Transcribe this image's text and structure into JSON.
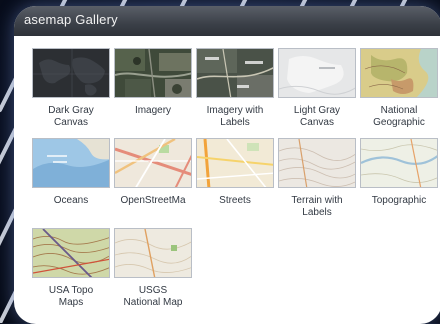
{
  "gallery": {
    "title": "asemap Gallery",
    "items": [
      {
        "label": "Dark Gray\nCanvas",
        "icon": "dark-gray-canvas-thumbnail"
      },
      {
        "label": "Imagery",
        "icon": "imagery-thumbnail"
      },
      {
        "label": "Imagery with\nLabels",
        "icon": "imagery-with-labels-thumbnail"
      },
      {
        "label": "Light Gray\nCanvas",
        "icon": "light-gray-canvas-thumbnail"
      },
      {
        "label": "National\nGeographic",
        "icon": "national-geographic-thumbnail"
      },
      {
        "label": "Oceans",
        "icon": "oceans-thumbnail"
      },
      {
        "label": "OpenStreetMa",
        "icon": "openstreetmap-thumbnail"
      },
      {
        "label": "Streets",
        "icon": "streets-thumbnail"
      },
      {
        "label": "Terrain with\nLabels",
        "icon": "terrain-with-labels-thumbnail"
      },
      {
        "label": "Topographic",
        "icon": "topographic-thumbnail"
      },
      {
        "label": "USA Topo\nMaps",
        "icon": "usa-topo-maps-thumbnail"
      },
      {
        "label": "USGS\nNational Map",
        "icon": "usgs-national-map-thumbnail"
      }
    ]
  }
}
